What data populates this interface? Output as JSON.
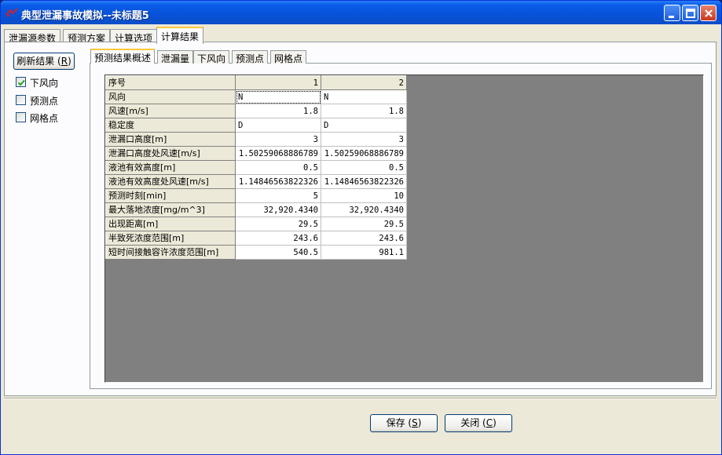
{
  "window": {
    "title": "典型泄漏事故模拟--未标题5"
  },
  "top_tabs": [
    {
      "label": "泄漏源参数"
    },
    {
      "label": "预测方案"
    },
    {
      "label": "计算选项"
    },
    {
      "label": "计算结果",
      "active": true
    }
  ],
  "sidebar": {
    "refresh": {
      "label": "刷新结果",
      "key": "R"
    },
    "checks": [
      {
        "label": "下风向",
        "checked": true
      },
      {
        "label": "预测点",
        "checked": false
      },
      {
        "label": "网格点",
        "checked": false
      }
    ]
  },
  "inner_tabs": [
    {
      "label": "预测结果概述",
      "active": true
    },
    {
      "label": "泄漏量"
    },
    {
      "label": "下风向"
    },
    {
      "label": "预测点"
    },
    {
      "label": "网格点"
    }
  ],
  "grid": {
    "header": {
      "label": "序号",
      "cols": [
        "1",
        "2"
      ]
    },
    "rows": [
      {
        "label": "风向",
        "values": [
          "N",
          "N"
        ],
        "align": "txt"
      },
      {
        "label": "风速[m/s]",
        "values": [
          "1.8",
          "1.8"
        ],
        "align": "num"
      },
      {
        "label": "稳定度",
        "values": [
          "D",
          "D"
        ],
        "align": "txt"
      },
      {
        "label": "泄漏口高度[m]",
        "values": [
          "3",
          "3"
        ],
        "align": "num"
      },
      {
        "label": "泄漏口高度处风速[m/s]",
        "values": [
          "1.50259068886789",
          "1.50259068886789"
        ],
        "align": "num"
      },
      {
        "label": "液池有效高度[m]",
        "values": [
          "0.5",
          "0.5"
        ],
        "align": "num"
      },
      {
        "label": "液池有效高度处风速[m/s]",
        "values": [
          "1.14846563822326",
          "1.14846563822326"
        ],
        "align": "num"
      },
      {
        "label": "预测时刻[min]",
        "values": [
          "5",
          "10"
        ],
        "align": "num"
      },
      {
        "label": "最大落地浓度[mg/m^3]",
        "values": [
          "32,920.4340",
          "32,920.4340"
        ],
        "align": "num"
      },
      {
        "label": "出现距离[m]",
        "values": [
          "29.5",
          "29.5"
        ],
        "align": "num"
      },
      {
        "label": "半致死浓度范围[m]",
        "values": [
          "243.6",
          "243.6"
        ],
        "align": "num"
      },
      {
        "label": "短时间接触容许浓度范围[m]",
        "values": [
          "540.5",
          "981.1"
        ],
        "align": "num"
      }
    ]
  },
  "buttons": {
    "save": {
      "label": "保存",
      "key": "S"
    },
    "close": {
      "label": "关闭",
      "key": "C"
    }
  },
  "colors": {
    "title_bar": "#0852d8",
    "dialog_bg": "#ece9d8",
    "grid_bg": "#808080",
    "active_tab_accent": "#ffc83c"
  }
}
